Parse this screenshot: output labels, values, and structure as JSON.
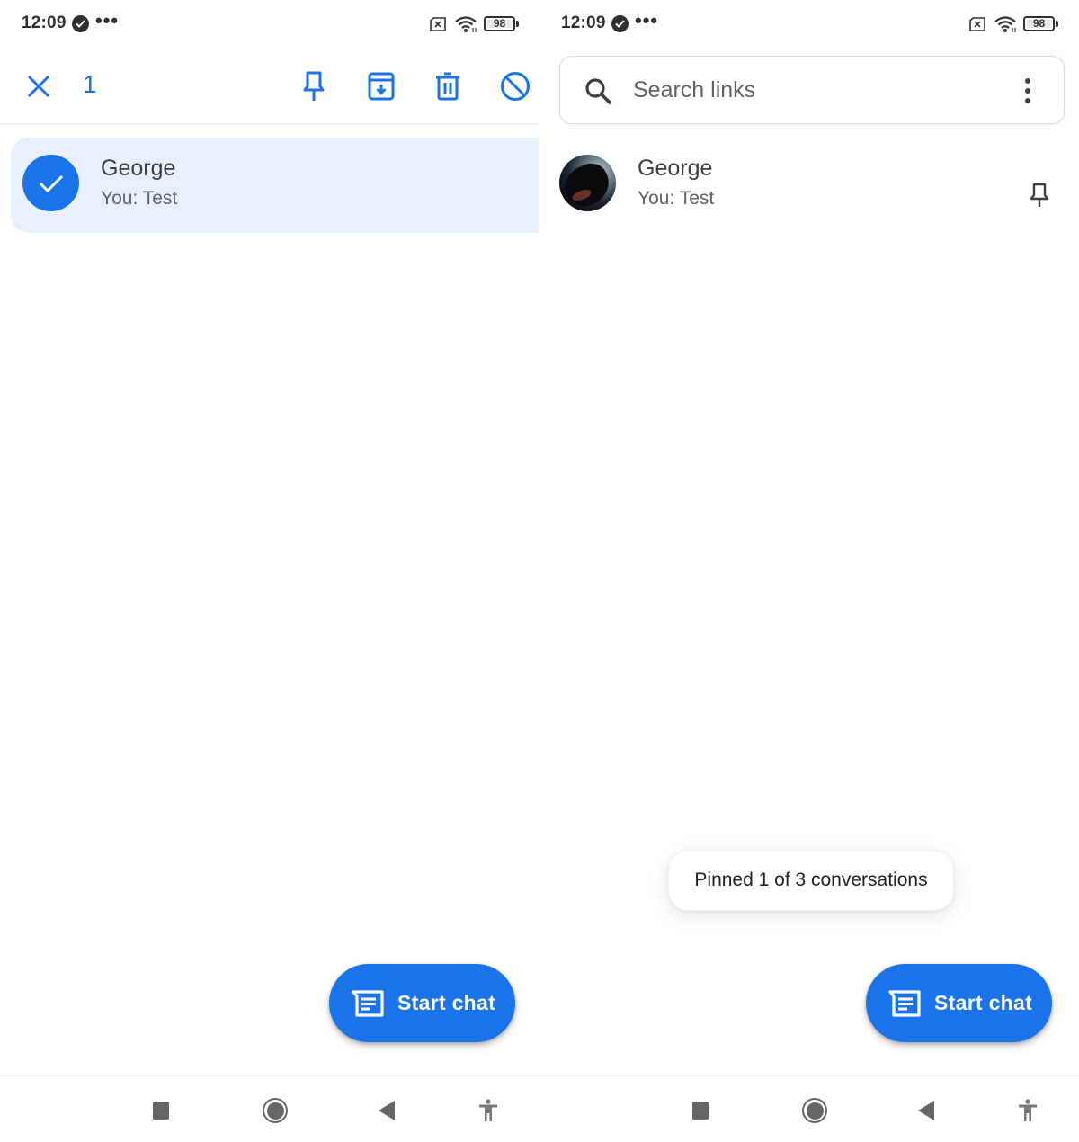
{
  "status_bar": {
    "time": "12:09",
    "notification_dots": "•••",
    "battery_level": "98",
    "icons": [
      "verified-check-icon",
      "no-sim-icon",
      "wifi-icon",
      "battery-icon"
    ]
  },
  "left_screen": {
    "selection_toolbar": {
      "close_icon": "close-icon",
      "selected_count": "1",
      "actions": [
        {
          "name": "pin",
          "icon": "pin-icon"
        },
        {
          "name": "archive",
          "icon": "archive-icon"
        },
        {
          "name": "delete",
          "icon": "trash-icon"
        },
        {
          "name": "block",
          "icon": "block-icon"
        }
      ]
    },
    "conversations": [
      {
        "name": "George",
        "snippet": "You: Test",
        "selected": true
      }
    ],
    "fab": {
      "label": "Start chat",
      "icon": "chat-icon"
    }
  },
  "right_screen": {
    "search": {
      "placeholder": "Search links",
      "icon": "search-icon",
      "menu_icon": "more-vert-icon"
    },
    "conversations": [
      {
        "name": "George",
        "snippet": "You: Test",
        "pinned": true
      }
    ],
    "toast": {
      "message": "Pinned 1 of 3 conversations"
    },
    "fab": {
      "label": "Start chat",
      "icon": "chat-icon"
    }
  },
  "nav_bar": {
    "buttons": [
      "recents",
      "home",
      "back",
      "accessibility"
    ]
  },
  "colors": {
    "accent": "#1a73e8",
    "selected_row": "#e8f0fe",
    "text_primary": "#3c4043",
    "text_secondary": "#5f6368"
  }
}
